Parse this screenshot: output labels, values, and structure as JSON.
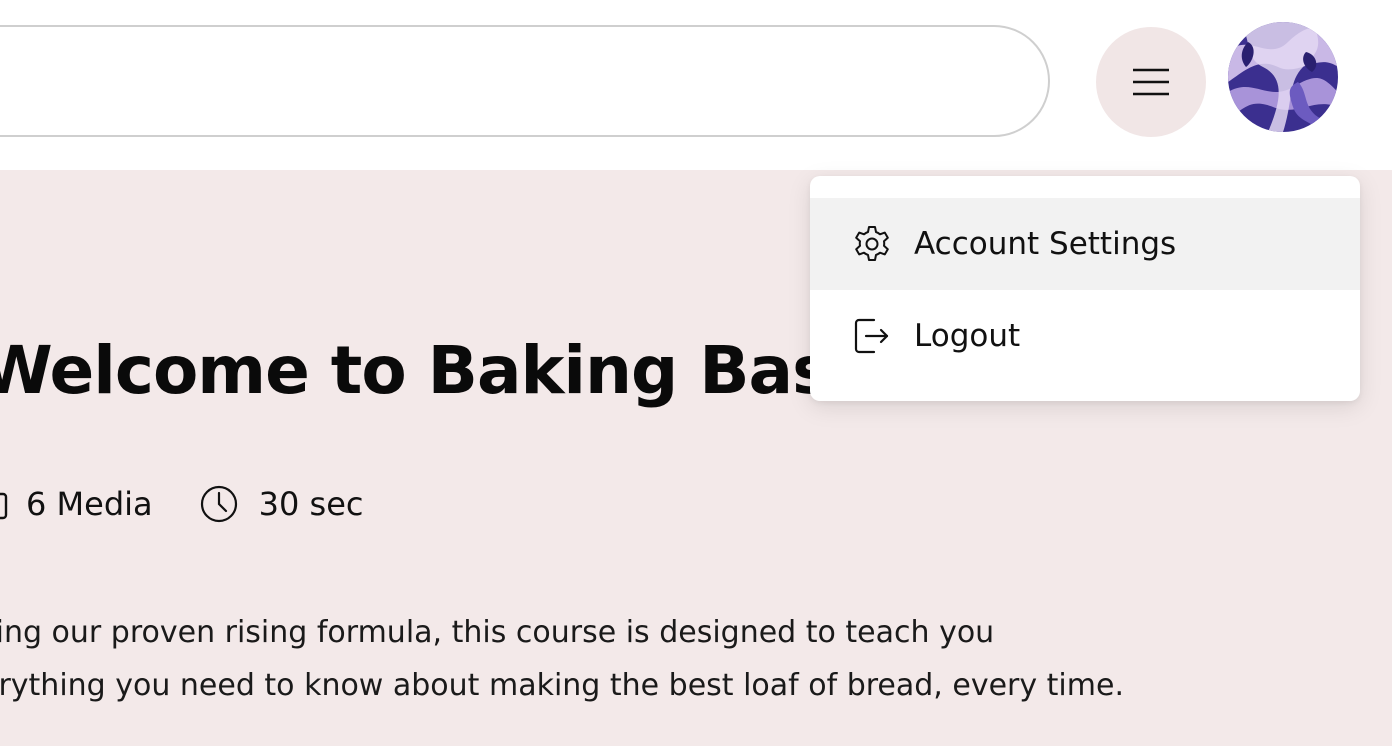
{
  "header": {
    "search_value": "",
    "menu_icon": "hamburger-menu-icon",
    "avatar_alt": "user-avatar"
  },
  "course": {
    "title": "Welcome to Baking Bas",
    "media_count": "6 Media",
    "duration": "30 sec",
    "description_line1": "sing our proven rising formula, this course is designed to teach you",
    "description_line2": "erything you need to know about making the best loaf of bread, every time."
  },
  "dropdown": {
    "items": [
      {
        "label": "Account Settings",
        "icon": "gear-icon"
      },
      {
        "label": "Logout",
        "icon": "logout-icon"
      }
    ]
  },
  "colors": {
    "page_bg": "#f3e9e9",
    "header_bg": "#ffffff",
    "menu_button_bg": "#f1e6e6",
    "hover_row_bg": "#f2f2f2",
    "avatar_primary": "#3b2f8f",
    "avatar_secondary": "#c9b8e6"
  }
}
